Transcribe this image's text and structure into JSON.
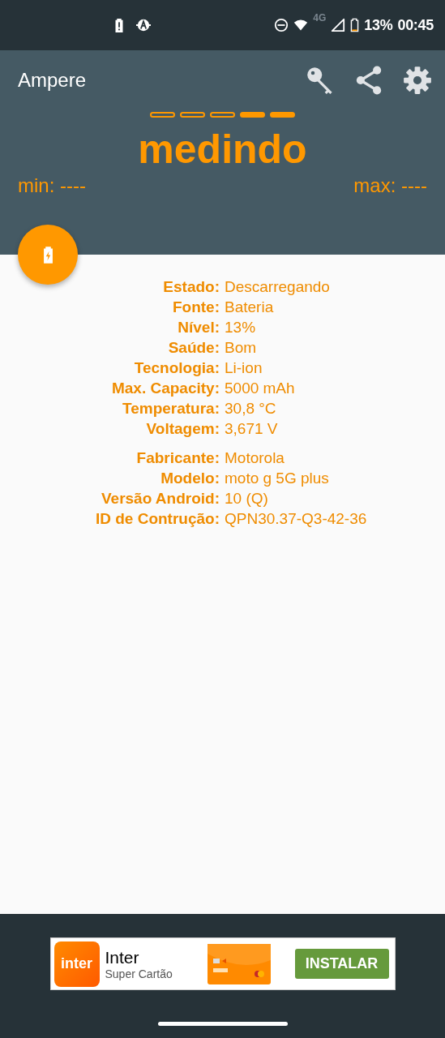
{
  "status_bar": {
    "battery_percent": "13%",
    "network": "4G",
    "time": "00:45"
  },
  "app_bar": {
    "title": "Ampere"
  },
  "meter": {
    "segments": [
      {
        "filled": false
      },
      {
        "filled": false
      },
      {
        "filled": false
      },
      {
        "filled": true
      },
      {
        "filled": true
      }
    ],
    "status": "medindo",
    "min": "min: ----",
    "max": "max: ----"
  },
  "info_groups": [
    {
      "rows": [
        {
          "label": "Estado:",
          "value": "Descarregando"
        },
        {
          "label": "Fonte:",
          "value": "Bateria"
        },
        {
          "label": "Nível:",
          "value": "13%"
        },
        {
          "label": "Saúde:",
          "value": "Bom"
        },
        {
          "label": "Tecnologia:",
          "value": "Li-ion"
        },
        {
          "label": "Max. Capacity:",
          "value": "5000 mAh"
        },
        {
          "label": "Temperatura:",
          "value": "30,8 °C"
        },
        {
          "label": "Voltagem:",
          "value": "3,671 V"
        }
      ]
    },
    {
      "rows": [
        {
          "label": "Fabricante:",
          "value": "Motorola"
        },
        {
          "label": "Modelo:",
          "value": "moto g 5G plus"
        },
        {
          "label": "Versão Android:",
          "value": "10 (Q)"
        },
        {
          "label": "ID de Contrução:",
          "value": "QPN30.37-Q3-42-36"
        }
      ]
    }
  ],
  "ad": {
    "logo": "inter",
    "title": "Inter",
    "subtitle": "Super Cartão",
    "button": "INSTALAR"
  }
}
